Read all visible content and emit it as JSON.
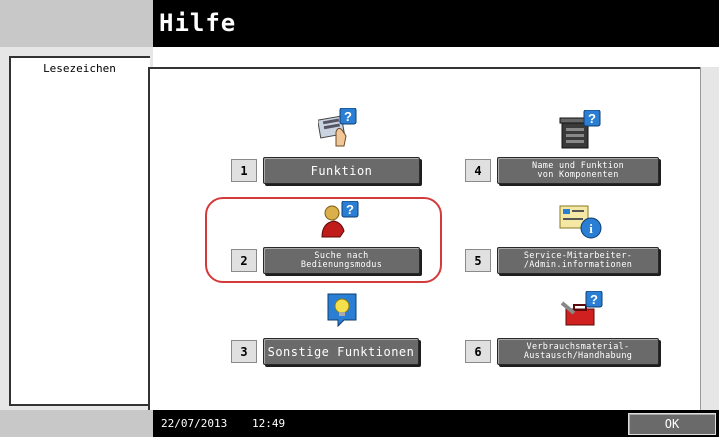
{
  "header": {
    "title": "Hilfe"
  },
  "bookmark_tab": {
    "label": "Lesezeichen"
  },
  "menu": [
    {
      "number": "1",
      "lines": [
        "Funktion"
      ],
      "icon": "manual-hand-icon"
    },
    {
      "number": "2",
      "lines": [
        "Suche nach",
        "Bedienungsmodus"
      ],
      "icon": "person-search-icon"
    },
    {
      "number": "3",
      "lines": [
        "Sonstige Funktionen"
      ],
      "icon": "lightbulb-icon"
    },
    {
      "number": "4",
      "lines": [
        "Name und Funktion",
        "von Komponenten"
      ],
      "icon": "copier-machine-icon"
    },
    {
      "number": "5",
      "lines": [
        "Service-Mitarbeiter-",
        "/Admin.informationen"
      ],
      "icon": "id-card-info-icon"
    },
    {
      "number": "6",
      "lines": [
        "Verbrauchsmaterial-",
        "Austausch/Handhabung"
      ],
      "icon": "toolbox-icon"
    }
  ],
  "status": {
    "date": "22/07/2013",
    "time": "12:49"
  },
  "footer": {
    "ok_label": "OK"
  },
  "colors": {
    "highlight": "#d43a3a",
    "button": "#6a6a6a",
    "help_badge": "#2a7fd4"
  }
}
